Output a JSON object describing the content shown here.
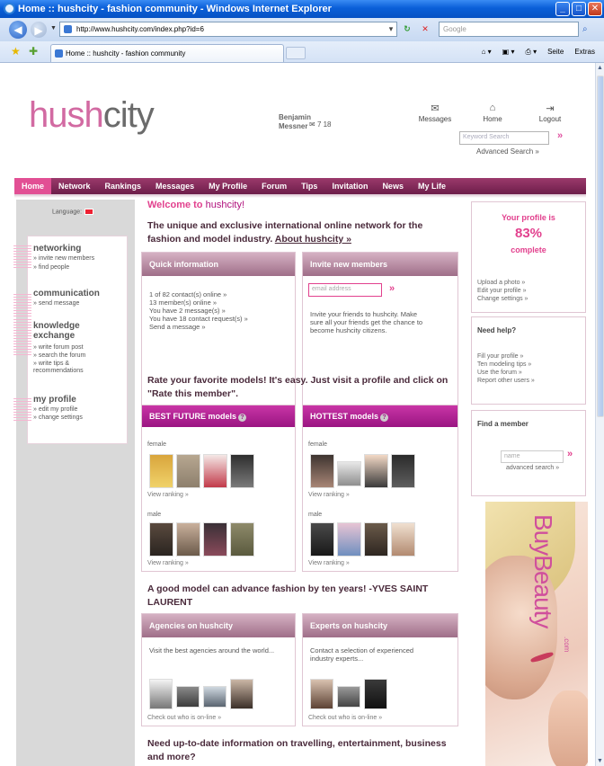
{
  "window": {
    "title": "Home :: hushcity - fashion community - Windows Internet Explorer",
    "address": "http://www.hushcity.com/index.php?id=6",
    "search_placeholder": "Google",
    "tab_title": "Home :: hushcity - fashion community",
    "cmd": [
      "Seite",
      "Extras"
    ]
  },
  "header": {
    "logo_hush": "hush",
    "logo_city": "city",
    "user_first": "Benjamin",
    "user_last": "Messner",
    "user_stats": "7  18",
    "icons": [
      {
        "label": "Messages",
        "icon": "envelope-icon"
      },
      {
        "label": "Home",
        "icon": "home-icon"
      },
      {
        "label": "Logout",
        "icon": "logout-icon"
      }
    ],
    "keyword_placeholder": "Keyword Search",
    "advanced_search": "Advanced Search »"
  },
  "nav": [
    "Home",
    "Network",
    "Rankings",
    "Messages",
    "My Profile",
    "Forum",
    "Tips",
    "Invitation",
    "News",
    "My Life"
  ],
  "left": {
    "language": "Language:",
    "sections": [
      {
        "title": "networking",
        "links": [
          "» invite new members",
          "» find people"
        ]
      },
      {
        "title": "communication",
        "links": [
          "» send message"
        ]
      },
      {
        "title": "knowledge exchange",
        "links": [
          "» write forum post",
          "» search the forum",
          "» write tips &",
          "recommendations"
        ]
      },
      {
        "title": "my profile",
        "links": [
          "» edit my profile",
          "» change settings"
        ]
      }
    ]
  },
  "center": {
    "welcome": "Welcome to ",
    "welcome_brand": "hushcity!",
    "intro": "The unique and exclusive international online network for the fashion and model industry.",
    "about": "About hushcity »",
    "quick_info": {
      "title": "Quick information",
      "lines": [
        "1 of 82 contact(s) online »",
        "13 member(s) online »",
        "You have 2 message(s) »",
        "You have 18 contact request(s) »",
        "Send a message »"
      ]
    },
    "invite": {
      "title": "Invite new members",
      "placeholder": "email address",
      "text": "Invite your friends to hushcity. Make sure all your friends get the chance to become hushcity citizens."
    },
    "rate_text": "Rate your favorite models! It's easy. Just visit a profile and click on \"Rate this member\".",
    "best_future": {
      "title": "BEST FUTURE models",
      "female": "female",
      "male": "male",
      "view": "View ranking »"
    },
    "hottest": {
      "title": "HOTTEST models",
      "female": "female",
      "male": "male",
      "view": "View ranking »"
    },
    "quote": "A good model can advance fashion by ten years! -YVES SAINT LAURENT",
    "agencies": {
      "title": "Agencies on hushcity",
      "text": "Visit the best agencies around the world...",
      "link": "Check out who is on-line »"
    },
    "experts": {
      "title": "Experts on hushcity",
      "text": "Contact a selection of experienced industry experts...",
      "link": "Check out who is on-line »"
    },
    "need_info": "Need up-to-date information on travelling, entertainment, business and more?"
  },
  "right": {
    "profile": {
      "title": "Your profile is",
      "pct": "83%",
      "complete": "complete",
      "links": [
        "Upload a photo »",
        "Edit your profile »",
        "Change settings »"
      ]
    },
    "help": {
      "title": "Need help?",
      "links": [
        "Fill your profile »",
        "Ten modeling tips »",
        "Use the forum »",
        "Report other users »"
      ]
    },
    "find": {
      "title": "Find a member",
      "placeholder": "name",
      "advanced": "advanced search »"
    },
    "ad_brand": "BuyBeauty",
    "ad_suffix": ".com"
  }
}
